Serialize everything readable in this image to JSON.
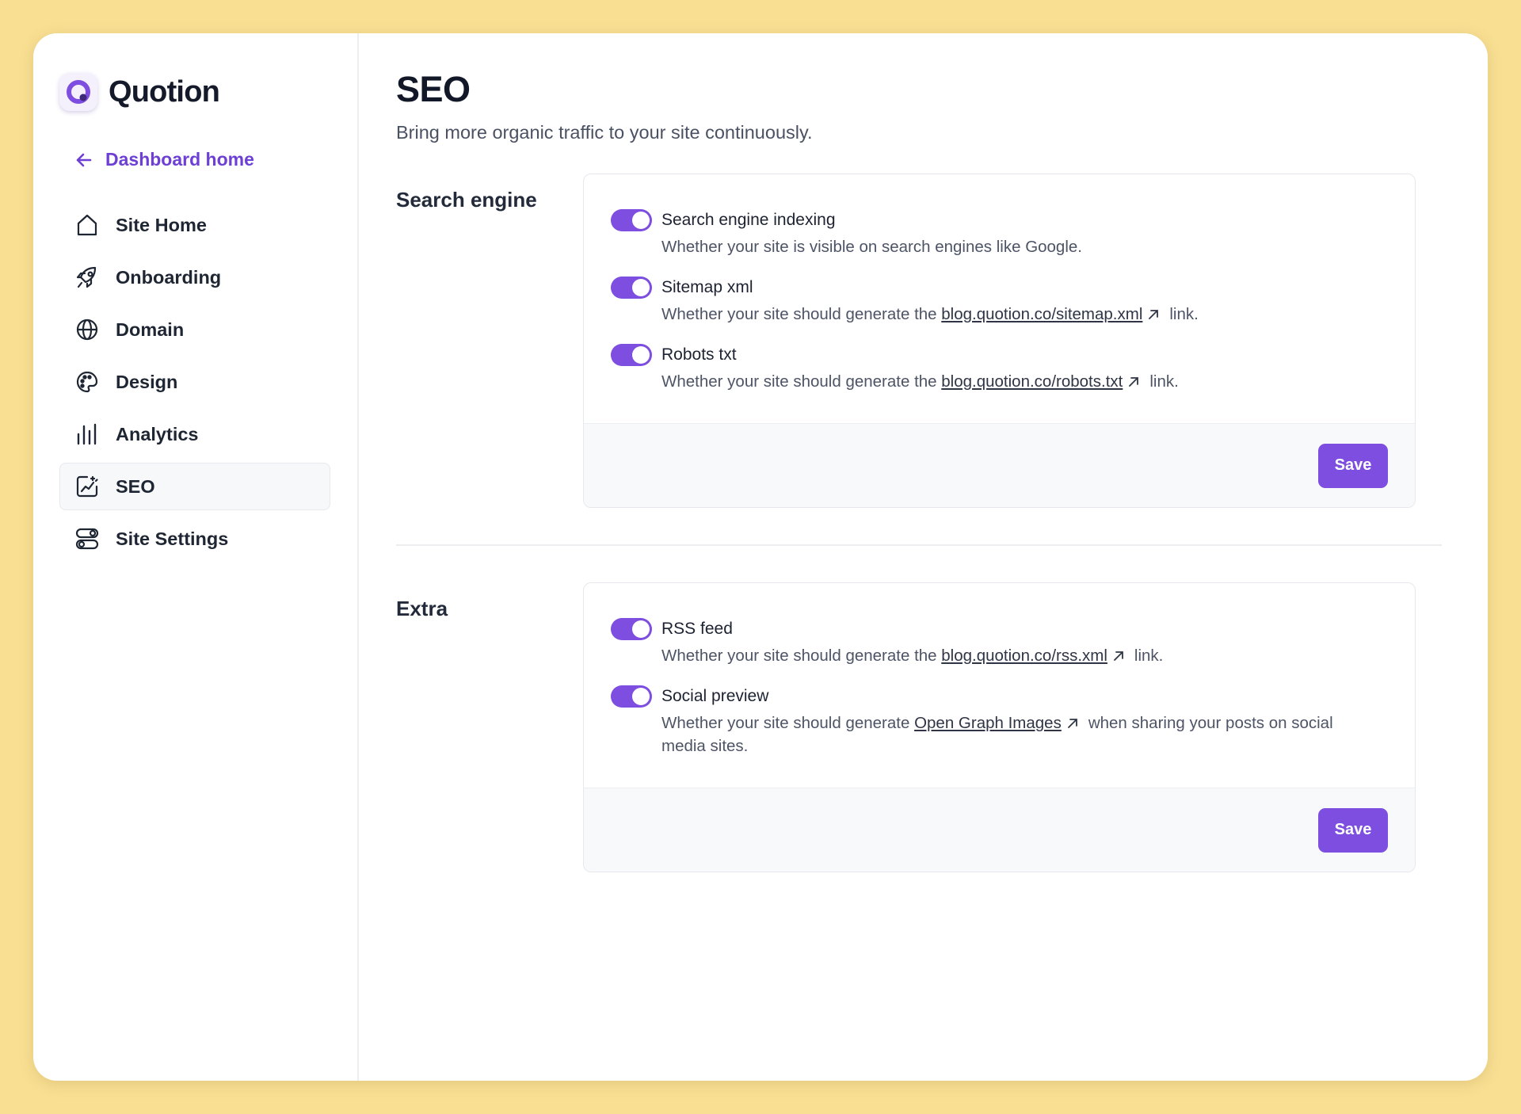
{
  "brand": {
    "name": "Quotion",
    "accent": "#7d4ee0"
  },
  "sidebar": {
    "back_label": "Dashboard home",
    "items": [
      {
        "label": "Site Home",
        "icon": "house-icon"
      },
      {
        "label": "Onboarding",
        "icon": "rocket-icon"
      },
      {
        "label": "Domain",
        "icon": "globe-icon"
      },
      {
        "label": "Design",
        "icon": "palette-icon"
      },
      {
        "label": "Analytics",
        "icon": "bar-chart-icon"
      },
      {
        "label": "SEO",
        "icon": "seo-chart-icon",
        "active": true
      },
      {
        "label": "Site Settings",
        "icon": "toggles-icon"
      }
    ]
  },
  "page": {
    "title": "SEO",
    "subtitle": "Bring more organic traffic to your site continuously."
  },
  "sections": {
    "search_engine": {
      "label": "Search engine",
      "save_label": "Save",
      "toggles": [
        {
          "title": "Search engine indexing",
          "on": true,
          "desc": "Whether your site is visible on search engines like Google."
        },
        {
          "title": "Sitemap xml",
          "on": true,
          "desc_before": "Whether your site should generate the ",
          "link": "blog.quotion.co/sitemap.xml",
          "desc_after": "link."
        },
        {
          "title": "Robots txt",
          "on": true,
          "desc_before": "Whether your site should generate the ",
          "link": "blog.quotion.co/robots.txt",
          "desc_after": "link."
        }
      ]
    },
    "extra": {
      "label": "Extra",
      "save_label": "Save",
      "toggles": [
        {
          "title": "RSS feed",
          "on": true,
          "desc_before": "Whether your site should generate the ",
          "link": "blog.quotion.co/rss.xml",
          "desc_after": "link."
        },
        {
          "title": "Social preview",
          "on": true,
          "desc_before": "Whether your site should generate ",
          "link": "Open Graph Images",
          "desc_after": "when sharing your posts on social media sites."
        }
      ]
    }
  }
}
